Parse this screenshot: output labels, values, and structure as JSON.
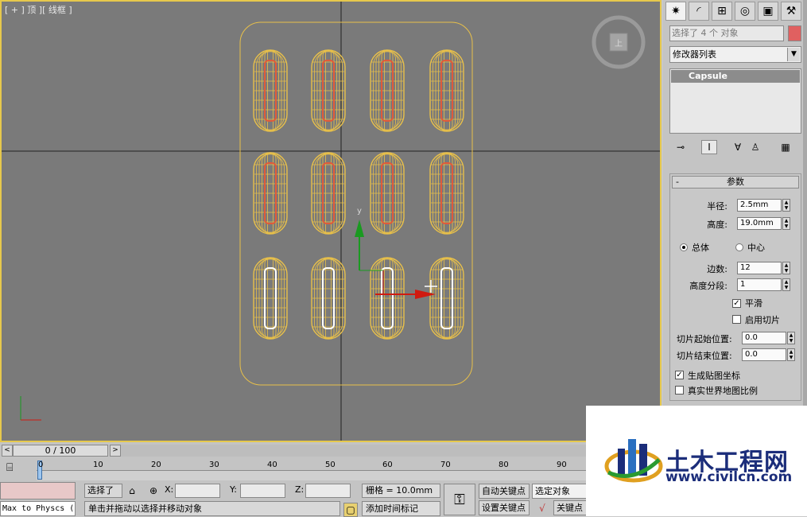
{
  "viewport": {
    "label": "[ + ] 顶 ][ 线框 ]",
    "viewcube_label": "上",
    "capsule_rows": 3,
    "capsule_cols": 4,
    "gizmo_y_label": "y",
    "colors": {
      "wire": "#e8c04a",
      "selected_core": "#e05a3a",
      "white_core": "#ffffff",
      "background": "#7a7a7a",
      "x_axis": "#d01a10",
      "y_axis": "#1a9a20"
    }
  },
  "command_panel": {
    "tabs": [
      "create-icon",
      "modify-icon",
      "hierarchy-icon",
      "motion-icon",
      "display-icon",
      "utilities-icon"
    ],
    "object_name": "选择了 4 个 对象",
    "object_color": "#e06060",
    "modifier_list": "修改器列表",
    "stack_item": "Capsule",
    "params": {
      "header": "参数",
      "collapse": "-",
      "radius_label": "半径:",
      "radius_value": "2.5mm",
      "height_label": "高度:",
      "height_value": "19.0mm",
      "overall_label": "总体",
      "center_label": "中心",
      "sides_label": "边数:",
      "sides_value": "12",
      "height_segs_label": "高度分段:",
      "height_segs_value": "1",
      "smooth_label": "平滑",
      "smooth_checked": true,
      "slice_on_label": "启用切片",
      "slice_on_checked": false,
      "slice_from_label": "切片起始位置:",
      "slice_from_value": "0.0",
      "slice_to_label": "切片结束位置:",
      "slice_to_value": "0.0",
      "gen_map_label": "生成贴图坐标",
      "gen_map_checked": true,
      "real_world_label": "真实世界地图比例",
      "real_world_checked": false
    }
  },
  "timeline": {
    "prev": "<",
    "slider": "0 / 100",
    "next": ">"
  },
  "ruler": {
    "ticks": [
      "0",
      "10",
      "20",
      "30",
      "40",
      "50",
      "60",
      "70",
      "80",
      "90"
    ]
  },
  "status": {
    "maxscript": "Max to Physcs (",
    "selection": "选择了",
    "x_label": "X:",
    "y_label": "Y:",
    "z_label": "Z:",
    "grid": "栅格 = 10.0mm",
    "prompt": "单击并拖动以选择并移动对象",
    "add_time_tag": "添加时间标记",
    "auto_key": "自动关键点",
    "set_key": "设置关键点",
    "selected_obj": "选定对象",
    "key_points": "关键点"
  },
  "watermark": {
    "cn": "土木工程网",
    "url": "www.civilcn.com"
  }
}
